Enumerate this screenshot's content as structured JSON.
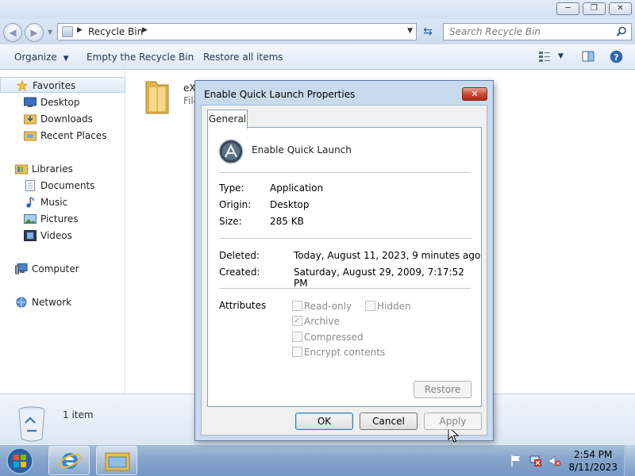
{
  "explorer": {
    "window_controls": {
      "minimize": "─",
      "maximize": "❐",
      "close": "✕"
    },
    "address": {
      "segments": [
        "Recycle Bin"
      ]
    },
    "search": {
      "placeholder": "Search Recycle Bin"
    },
    "toolbar": {
      "organize": "Organize",
      "empty": "Empty the Recycle Bin",
      "restore_all": "Restore all items"
    },
    "sidebar": {
      "favorites": "Favorites",
      "desktop": "Desktop",
      "downloads": "Downloads",
      "recent": "Recent Places",
      "libraries": "Libraries",
      "documents": "Documents",
      "music": "Music",
      "pictures": "Pictures",
      "videos": "Videos",
      "computer": "Computer",
      "network": "Network"
    },
    "content": {
      "item_name": "eX",
      "item_sub": "File"
    },
    "details": {
      "count": "1 item"
    }
  },
  "dialog": {
    "title": "Enable Quick Launch Properties",
    "close": "✕",
    "tab": "General",
    "app_name": "Enable Quick Launch",
    "type_label": "Type:",
    "type_value": "Application",
    "origin_label": "Origin:",
    "origin_value": "Desktop",
    "size_label": "Size:",
    "size_value": "285 KB",
    "deleted_label": "Deleted:",
    "deleted_value": "Today, August 11, 2023, 9 minutes ago",
    "created_label": "Created:",
    "created_value": "Saturday, August 29, 2009, 7:17:52 PM",
    "attributes_label": "Attributes",
    "attributes": {
      "readonly": {
        "label": "Read-only",
        "checked": false
      },
      "hidden": {
        "label": "Hidden",
        "checked": false
      },
      "archive": {
        "label": "Archive",
        "checked": true
      },
      "compressed": {
        "label": "Compressed",
        "checked": false
      },
      "encrypt": {
        "label": "Encrypt contents",
        "checked": false
      }
    },
    "restore": "Restore",
    "ok": "OK",
    "cancel": "Cancel",
    "apply": "Apply"
  },
  "taskbar": {
    "time": "2:54 PM",
    "date": "8/11/2023"
  },
  "colors": {
    "taskbar": "#7397c4",
    "dialog_frame": "#c9daee",
    "close_red": "#c84a35",
    "toolbar_text": "#1e395b"
  }
}
